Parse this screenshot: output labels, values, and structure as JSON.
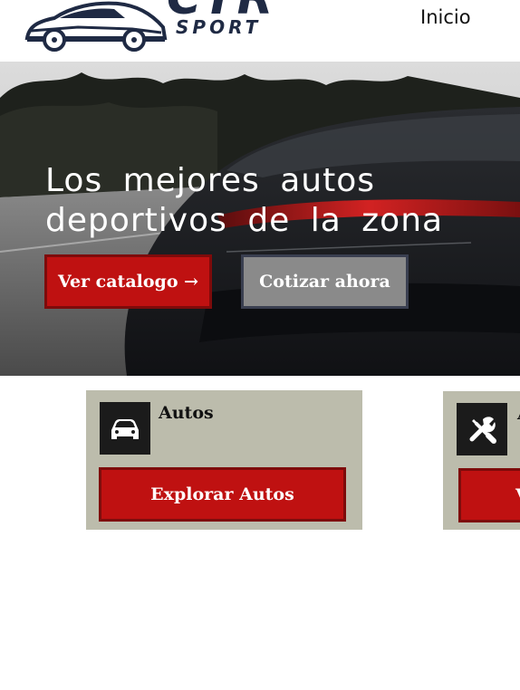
{
  "header": {
    "logo": {
      "brand": "CTR",
      "sub": "SPORT"
    },
    "nav": {
      "inicio": "Inicio"
    }
  },
  "hero": {
    "title": "Los mejores autos deportivos de la zona",
    "buttons": {
      "catalogo": "Ver catalogo →",
      "cotizar": "Cotizar ahora"
    }
  },
  "cards": [
    {
      "title": "Autos",
      "button": "Explorar Autos",
      "icon": "car-icon"
    },
    {
      "title": "A",
      "button": "V",
      "icon": "tools-icon"
    }
  ],
  "colors": {
    "accent_red": "#bf1111",
    "red_border": "#7e0b0b",
    "card_bg": "#bcbcac",
    "logo_navy": "#1f2a44",
    "secondary_gray": "#8a8a8a"
  }
}
